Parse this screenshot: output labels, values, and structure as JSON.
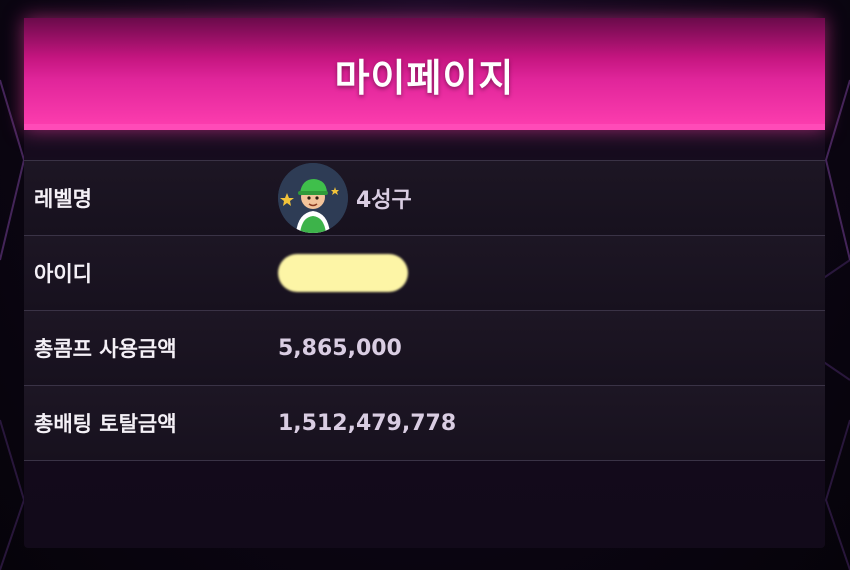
{
  "page": {
    "title": "마이페이지"
  },
  "rows": [
    {
      "label": "레벨명",
      "value": "4성구",
      "icon": "level-avatar-icon"
    },
    {
      "label": "아이디",
      "value": ""
    },
    {
      "label": "총콤프 사용금액",
      "value": "5,865,000"
    },
    {
      "label": "총배팅 토탈금액",
      "value": "1,512,479,778"
    }
  ],
  "colors": {
    "header_gradient_top": "#6a0a4a",
    "header_gradient_bottom": "#ff3fb0",
    "panel_bg": "#180d20",
    "label_text": "#f4f0f6",
    "value_text": "#d9cde2",
    "redaction": "#fdf5a6"
  }
}
